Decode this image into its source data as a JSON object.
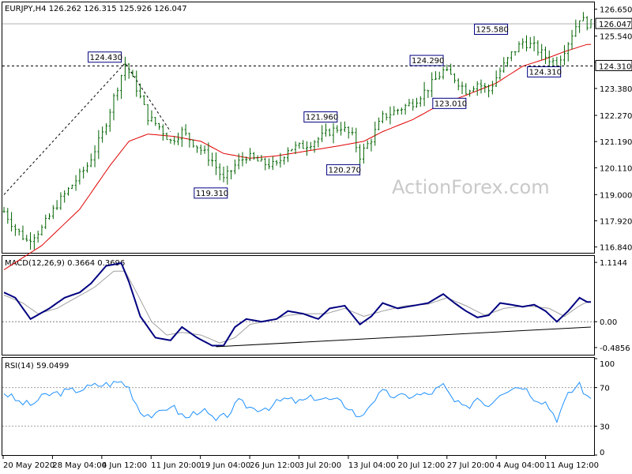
{
  "chart_data": {
    "type": "candlestick",
    "header": {
      "symbol": "EURJPY,H4",
      "open": "126.262",
      "high": "126.315",
      "low": "125.926",
      "close": "126.047"
    },
    "watermark": "ActionForex.com",
    "colors": {
      "candle": "#006400",
      "sma": "#e00000",
      "macd": "#000080",
      "signal": "#a0a0a0",
      "rsi": "#1e90ff",
      "trendline": "#000000",
      "label_border": "#000080"
    },
    "price_panel": {
      "ylim": [
        116.6,
        126.9
      ],
      "y_ticks": [
        "126.650",
        "125.540",
        "124.460",
        "123.380",
        "122.270",
        "121.190",
        "120.110",
        "119.000",
        "117.920",
        "116.840"
      ],
      "current_price_label": "126.047",
      "horizontal_level": {
        "value": 124.31,
        "label": "124.310"
      },
      "current_price_value": 126.047,
      "pivot_labels": [
        {
          "text": "124.430",
          "value": 124.43,
          "date": "2 Jun 20:00",
          "position": "above"
        },
        {
          "text": "119.310",
          "value": 119.31,
          "date": "19 Jun 04:00",
          "position": "below"
        },
        {
          "text": "121.960",
          "value": 121.96,
          "date": "8 Jul 04:00",
          "position": "above"
        },
        {
          "text": "120.270",
          "value": 120.27,
          "date": "10 Jul 08:00",
          "position": "below"
        },
        {
          "text": "124.290",
          "value": 124.29,
          "date": "21 Jul 12:00",
          "position": "above"
        },
        {
          "text": "123.010",
          "value": 123.01,
          "date": "24 Jul 04:00",
          "position": "below"
        },
        {
          "text": "125.580",
          "value": 125.58,
          "date": "31 Jul 04:00",
          "position": "above"
        },
        {
          "text": "124.310",
          "value": 124.31,
          "date": "7 Aug 12:00",
          "position": "below"
        }
      ],
      "close_path": [
        [
          0,
          118.3
        ],
        [
          3,
          117.6
        ],
        [
          6,
          117.1
        ],
        [
          10,
          117.6
        ],
        [
          14,
          118.6
        ],
        [
          18,
          119.4
        ],
        [
          22,
          120.2
        ],
        [
          26,
          121.5
        ],
        [
          29,
          123.0
        ],
        [
          32,
          124.4
        ],
        [
          35,
          123.4
        ],
        [
          38,
          122.2
        ],
        [
          41,
          121.8
        ],
        [
          44,
          121.2
        ],
        [
          47,
          121.6
        ],
        [
          51,
          121.0
        ],
        [
          55,
          120.4
        ],
        [
          58,
          119.6
        ],
        [
          61,
          120.2
        ],
        [
          64,
          120.6
        ],
        [
          68,
          120.3
        ],
        [
          72,
          120.2
        ],
        [
          75,
          120.9
        ],
        [
          79,
          121.0
        ],
        [
          83,
          121.3
        ],
        [
          86,
          121.6
        ],
        [
          89,
          121.8
        ],
        [
          92,
          121.4
        ],
        [
          94,
          120.6
        ],
        [
          97,
          121.3
        ],
        [
          100,
          122.2
        ],
        [
          104,
          122.5
        ],
        [
          108,
          122.8
        ],
        [
          112,
          123.4
        ],
        [
          116,
          124.1
        ],
        [
          119,
          123.8
        ],
        [
          122,
          123.3
        ],
        [
          125,
          123.6
        ],
        [
          128,
          123.3
        ],
        [
          131,
          124.1
        ],
        [
          134,
          124.8
        ],
        [
          137,
          125.3
        ],
        [
          140,
          125.1
        ],
        [
          143,
          124.7
        ],
        [
          146,
          124.4
        ],
        [
          149,
          125.3
        ],
        [
          152,
          126.3
        ],
        [
          154,
          126.05
        ]
      ],
      "sma_path": [
        [
          0,
          115.9
        ],
        [
          10,
          116.9
        ],
        [
          20,
          118.4
        ],
        [
          28,
          120.2
        ],
        [
          33,
          121.2
        ],
        [
          38,
          121.5
        ],
        [
          45,
          121.4
        ],
        [
          52,
          121.2
        ],
        [
          58,
          120.7
        ],
        [
          65,
          120.5
        ],
        [
          72,
          120.6
        ],
        [
          80,
          120.8
        ],
        [
          88,
          121.0
        ],
        [
          95,
          121.2
        ],
        [
          100,
          121.6
        ],
        [
          108,
          122.1
        ],
        [
          115,
          122.7
        ],
        [
          122,
          123.1
        ],
        [
          130,
          123.6
        ],
        [
          137,
          124.3
        ],
        [
          143,
          124.6
        ],
        [
          148,
          124.9
        ],
        [
          154,
          125.2
        ]
      ]
    },
    "macd_panel": {
      "title": "MACD(12,26,9) 0.3664 0.3696",
      "ylim": [
        -0.62,
        1.22
      ],
      "y_ticks": [
        "1.1144",
        "0.00",
        "-0.4856"
      ],
      "zero_marker": "0.00",
      "macd_path": [
        [
          0,
          0.55
        ],
        [
          3,
          0.45
        ],
        [
          7,
          0.05
        ],
        [
          12,
          0.25
        ],
        [
          16,
          0.45
        ],
        [
          20,
          0.55
        ],
        [
          23,
          0.72
        ],
        [
          27,
          1.05
        ],
        [
          31,
          1.1
        ],
        [
          33,
          0.75
        ],
        [
          36,
          0.1
        ],
        [
          40,
          -0.3
        ],
        [
          44,
          -0.35
        ],
        [
          47,
          -0.1
        ],
        [
          51,
          -0.3
        ],
        [
          55,
          -0.45
        ],
        [
          58,
          -0.45
        ],
        [
          61,
          -0.1
        ],
        [
          64,
          0.05
        ],
        [
          68,
          0.0
        ],
        [
          72,
          0.05
        ],
        [
          75,
          0.2
        ],
        [
          79,
          0.15
        ],
        [
          83,
          0.05
        ],
        [
          86,
          0.25
        ],
        [
          90,
          0.3
        ],
        [
          94,
          -0.05
        ],
        [
          97,
          0.1
        ],
        [
          100,
          0.35
        ],
        [
          104,
          0.25
        ],
        [
          108,
          0.3
        ],
        [
          112,
          0.35
        ],
        [
          116,
          0.52
        ],
        [
          119,
          0.35
        ],
        [
          122,
          0.2
        ],
        [
          125,
          0.08
        ],
        [
          128,
          0.12
        ],
        [
          131,
          0.35
        ],
        [
          134,
          0.32
        ],
        [
          137,
          0.28
        ],
        [
          140,
          0.32
        ],
        [
          143,
          0.2
        ],
        [
          146,
          0.0
        ],
        [
          149,
          0.2
        ],
        [
          152,
          0.45
        ],
        [
          154,
          0.37
        ]
      ],
      "signal_path": [
        [
          0,
          0.5
        ],
        [
          5,
          0.35
        ],
        [
          9,
          0.15
        ],
        [
          14,
          0.25
        ],
        [
          19,
          0.45
        ],
        [
          24,
          0.65
        ],
        [
          29,
          0.95
        ],
        [
          32,
          0.95
        ],
        [
          35,
          0.55
        ],
        [
          39,
          0.0
        ],
        [
          43,
          -0.25
        ],
        [
          47,
          -0.2
        ],
        [
          52,
          -0.25
        ],
        [
          57,
          -0.4
        ],
        [
          61,
          -0.3
        ],
        [
          65,
          -0.05
        ],
        [
          70,
          0.02
        ],
        [
          75,
          0.12
        ],
        [
          80,
          0.15
        ],
        [
          85,
          0.15
        ],
        [
          90,
          0.25
        ],
        [
          95,
          0.1
        ],
        [
          100,
          0.2
        ],
        [
          106,
          0.3
        ],
        [
          112,
          0.33
        ],
        [
          117,
          0.45
        ],
        [
          122,
          0.3
        ],
        [
          127,
          0.12
        ],
        [
          132,
          0.25
        ],
        [
          138,
          0.3
        ],
        [
          144,
          0.25
        ],
        [
          148,
          0.1
        ],
        [
          152,
          0.3
        ],
        [
          154,
          0.37
        ]
      ],
      "trendline": {
        "from": [
          56,
          -0.47
        ],
        "to": [
          155,
          -0.1
        ]
      }
    },
    "rsi_panel": {
      "title": "RSI(14) 59.0499",
      "ylim": [
        0,
        100
      ],
      "y_ticks": [
        "100",
        "70",
        "30",
        "0"
      ],
      "levels": [
        70,
        30
      ],
      "rsi_path": [
        [
          0,
          65
        ],
        [
          4,
          55
        ],
        [
          7,
          52
        ],
        [
          11,
          62
        ],
        [
          15,
          65
        ],
        [
          20,
          68
        ],
        [
          24,
          72
        ],
        [
          28,
          74
        ],
        [
          31,
          76
        ],
        [
          33,
          70
        ],
        [
          36,
          45
        ],
        [
          40,
          40
        ],
        [
          44,
          52
        ],
        [
          48,
          38
        ],
        [
          52,
          48
        ],
        [
          56,
          35
        ],
        [
          59,
          42
        ],
        [
          62,
          55
        ],
        [
          66,
          48
        ],
        [
          70,
          50
        ],
        [
          74,
          58
        ],
        [
          78,
          55
        ],
        [
          82,
          60
        ],
        [
          85,
          58
        ],
        [
          88,
          56
        ],
        [
          91,
          50
        ],
        [
          94,
          38
        ],
        [
          97,
          55
        ],
        [
          100,
          65
        ],
        [
          104,
          60
        ],
        [
          108,
          62
        ],
        [
          112,
          63
        ],
        [
          116,
          72
        ],
        [
          119,
          55
        ],
        [
          122,
          48
        ],
        [
          125,
          60
        ],
        [
          128,
          52
        ],
        [
          131,
          65
        ],
        [
          134,
          70
        ],
        [
          137,
          72
        ],
        [
          140,
          60
        ],
        [
          143,
          55
        ],
        [
          146,
          38
        ],
        [
          149,
          62
        ],
        [
          152,
          75
        ],
        [
          154,
          59
        ]
      ]
    },
    "x_axis": {
      "labels": [
        "20 May 2020",
        "28 May 04:00",
        "4 Jun 12:00",
        "11 Jun 20:00",
        "19 Jun 04:00",
        "26 Jun 12:00",
        "3 Jul 20:00",
        "13 Jul 04:00",
        "20 Jul 12:00",
        "27 Jul 20:00",
        "4 Aug 04:00",
        "11 Aug 12:00"
      ],
      "label_bars": [
        0,
        15,
        30,
        45,
        60,
        75,
        90,
        105,
        120,
        135,
        150,
        165
      ],
      "bar_count": 156
    }
  }
}
